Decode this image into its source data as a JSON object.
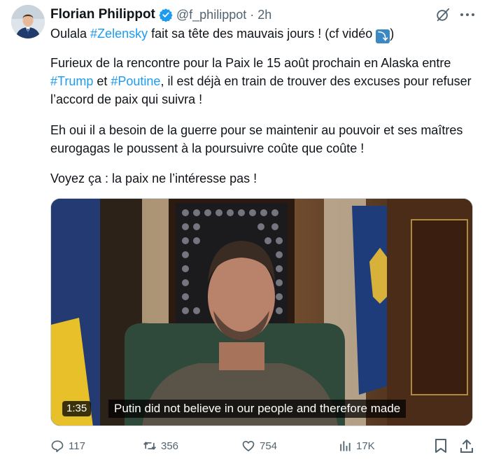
{
  "tweet": {
    "author_name": "Florian Philippot",
    "handle": "@f_philippot",
    "separator": "·",
    "time": "2h",
    "line1": {
      "prefix": "Oulala ",
      "hashtag": "#Zelensky",
      "suffix_a": " fait sa tête des mauvais jours ! (cf vidéo ",
      "emoji": "⤵",
      "suffix_b": ")"
    },
    "para2": {
      "line1": "Furieux de la rencontre pour la Paix le 15 août prochain en Alaska entre",
      "hashtag_trump": "#Trump",
      "connector": " et ",
      "hashtag_poutine": "#Poutine",
      "line2_suffix": ", il est déjà en train de trouver des excuses pour refuser",
      "line3": "l’accord de paix qui suivra !"
    },
    "para3": {
      "line1": "Eh oui il a besoin de la guerre pour se maintenir au pouvoir et ses maîtres",
      "line2": "eurogagas le poussent à la poursuivre coûte que coûte !"
    },
    "para4": "Voyez ça : la paix ne l’intéresse pas !"
  },
  "video": {
    "duration": "1:35",
    "subtitle": "Putin did not believe in our people and therefore made"
  },
  "actions": {
    "replies": "117",
    "reposts": "356",
    "likes": "754",
    "views": "17K"
  },
  "colors": {
    "accent": "#1d9bf0",
    "secondary_text": "#536471",
    "primary_text": "#0f1419"
  },
  "icons": [
    "verified-badge-icon",
    "grok-icon",
    "more-icon",
    "reply-icon",
    "repost-icon",
    "like-icon",
    "views-icon",
    "bookmark-icon",
    "share-icon"
  ]
}
